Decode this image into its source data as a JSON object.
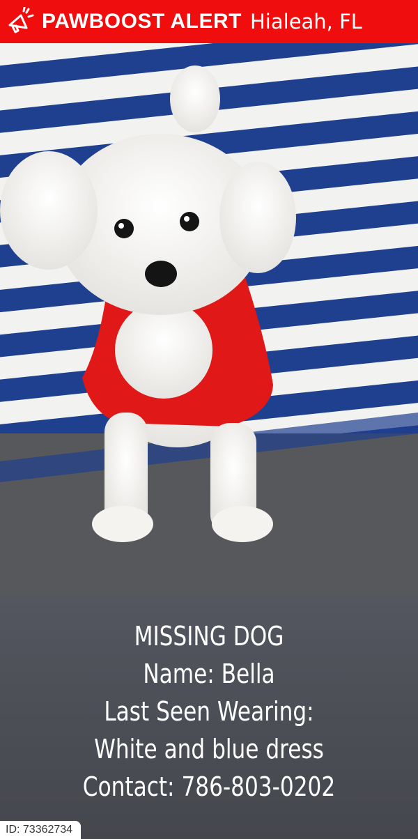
{
  "header": {
    "brand": "PAWBOOST ALERT",
    "location": "Hialeah, FL",
    "icon": "megaphone-icon",
    "color": "#f00d0d"
  },
  "photo": {
    "stripe_colors": [
      "#ffffff",
      "#1f3f8f"
    ],
    "dress_color": "#e01818"
  },
  "info": {
    "heading": "MISSING DOG",
    "name": "Name: Bella",
    "last_seen": "Last Seen Wearing: White and blue dress",
    "contact": "Contact: 786-803-0202"
  },
  "footer": {
    "id": "ID: 73362734"
  }
}
